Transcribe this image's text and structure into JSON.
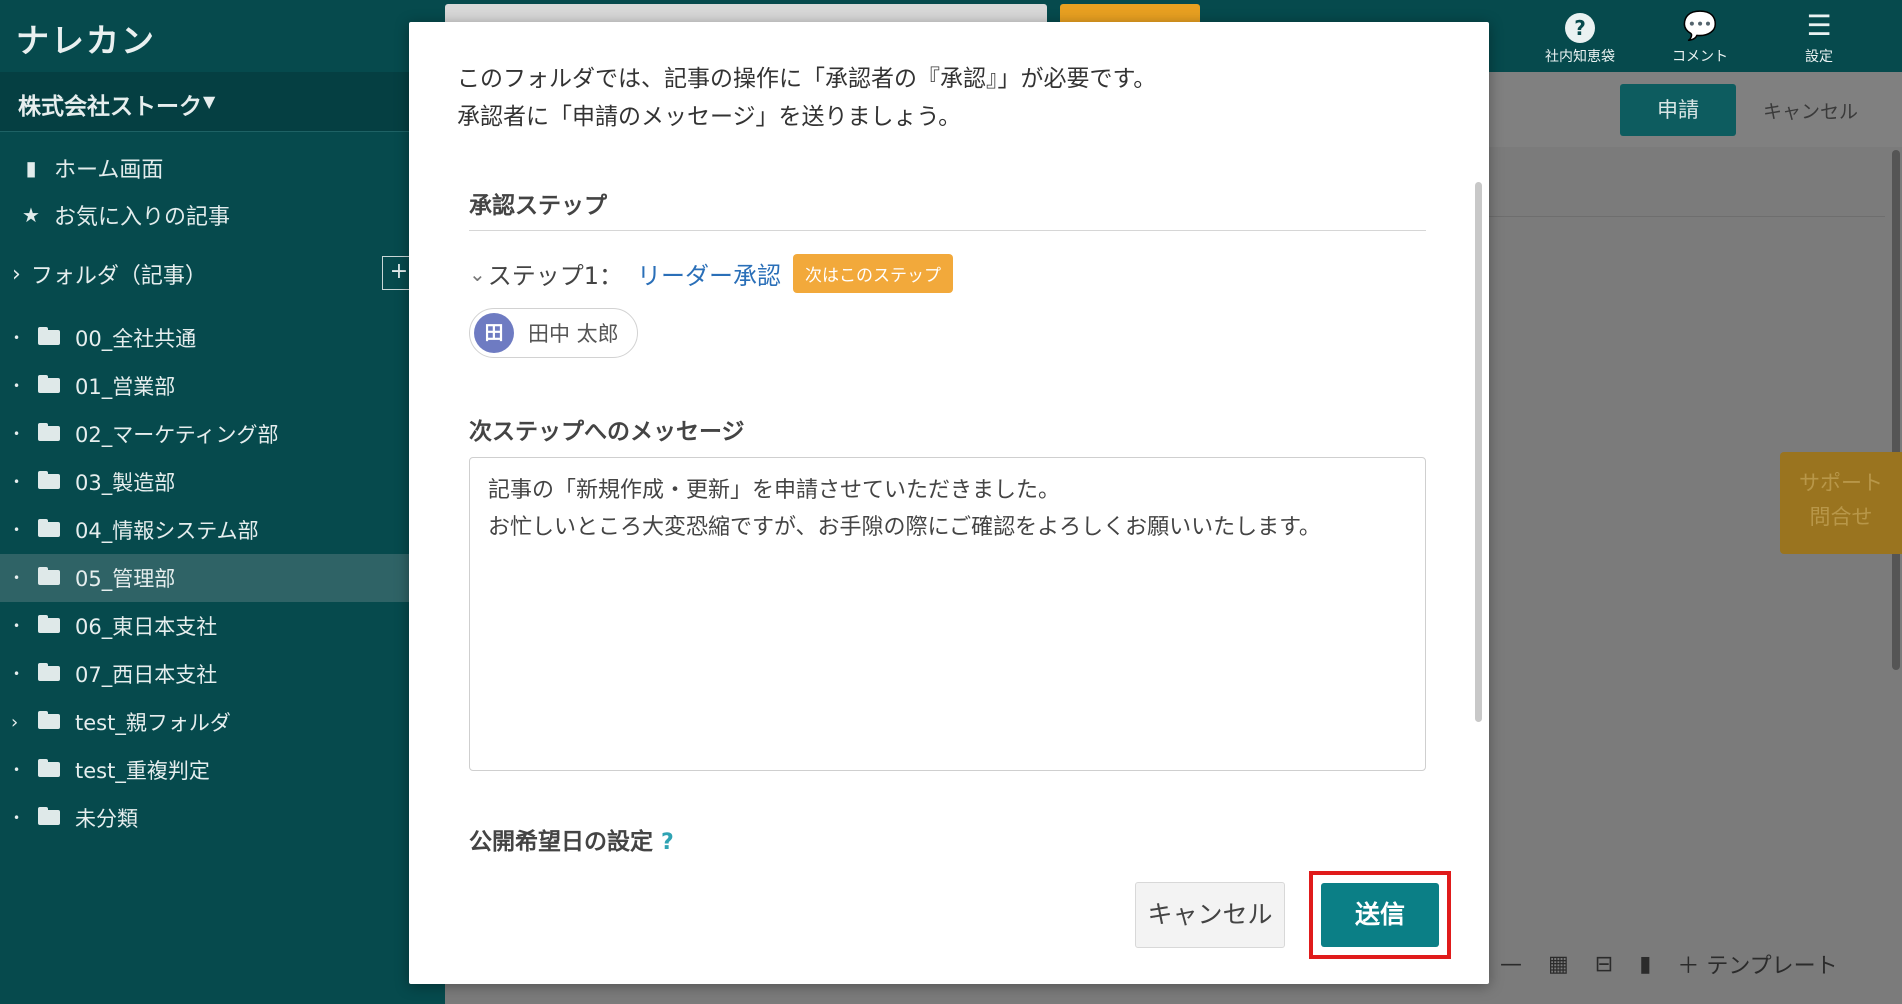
{
  "app": {
    "logo": "ナレカン",
    "company": "株式会社ストーク"
  },
  "sidebar": {
    "nav": [
      {
        "label": "ホーム画面",
        "icon": "clipboard-icon"
      },
      {
        "label": "お気に入りの記事",
        "icon": "star-icon"
      }
    ],
    "folder_header": "フォルダ（記事）",
    "folder_add": "+",
    "folders": [
      {
        "label": "00_全社共通",
        "marker": "•",
        "active": false
      },
      {
        "label": "01_営業部",
        "marker": "•",
        "active": false
      },
      {
        "label": "02_マーケティング部",
        "marker": "•",
        "active": false
      },
      {
        "label": "03_製造部",
        "marker": "•",
        "active": false
      },
      {
        "label": "04_情報システム部",
        "marker": "•",
        "active": false
      },
      {
        "label": "05_管理部",
        "marker": "•",
        "active": true
      },
      {
        "label": "06_東日本支社",
        "marker": "•",
        "active": false
      },
      {
        "label": "07_西日本支社",
        "marker": "•",
        "active": false
      },
      {
        "label": "test_親フォルダ",
        "marker": "›",
        "active": false
      },
      {
        "label": "test_重複判定",
        "marker": "•",
        "active": false
      },
      {
        "label": "未分類",
        "marker": "•",
        "active": false
      }
    ]
  },
  "topbar": {
    "items": [
      {
        "label": "社内知恵袋",
        "icon": "question-icon"
      },
      {
        "label": "コメント",
        "icon": "comment-icon"
      },
      {
        "label": "設定",
        "icon": "menu-icon"
      }
    ]
  },
  "toolbar": {
    "apply_label": "申請",
    "cancel_label": "キャンセル"
  },
  "support": {
    "line1": "サポート",
    "line2": "問合せ"
  },
  "editor_tools": {
    "template_label": "＋ テンプレート"
  },
  "modal": {
    "intro_line1": "このフォルダでは、記事の操作に「承認者の『承認』」が必要です。",
    "intro_line2": "承認者に「申請のメッセージ」を送りましょう。",
    "approval_steps_title": "承認ステップ",
    "step_label": "ステップ1：",
    "step_name": "リーダー承認",
    "step_badge": "次はこのステップ",
    "approver_initial": "田",
    "approver_name": "田中 太郎",
    "message_title": "次ステップへのメッセージ",
    "message_text": "記事の「新規作成・更新」を申請させていただきました。\nお忙しいところ大変恐縮ですが、お手隙の際にご確認をよろしくお願いいたします。",
    "publish_date_title": "公開希望日の設定",
    "publish_help": "?",
    "cancel_label": "キャンセル",
    "send_label": "送信"
  },
  "colors": {
    "sidebar_bg": "#064a4d",
    "accent": "#0b7f86",
    "badge": "#f2a93b",
    "highlight": "#e01b1b"
  }
}
